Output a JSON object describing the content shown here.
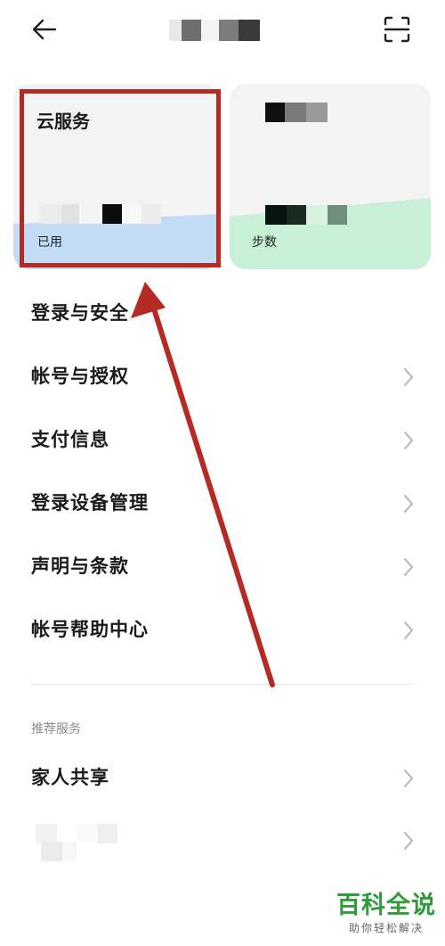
{
  "header": {
    "back_icon": "back-arrow-icon",
    "scan_icon": "scan-icon"
  },
  "cards": {
    "cloud": {
      "title": "云服务",
      "sub_label": "已用",
      "color": "#c2dcf6"
    },
    "steps": {
      "sub_label": "步数",
      "color": "#c7f0d6"
    }
  },
  "menu": [
    {
      "label": "登录与安全"
    },
    {
      "label": "帐号与授权"
    },
    {
      "label": "支付信息"
    },
    {
      "label": "登录设备管理"
    },
    {
      "label": "声明与条款"
    },
    {
      "label": "帐号帮助中心"
    }
  ],
  "recommended": {
    "heading": "推荐服务",
    "items": [
      {
        "label": "家人共享"
      }
    ]
  },
  "annotation": {
    "color": "#b52b24"
  },
  "watermark": {
    "main": "百科全说",
    "sub": "助你轻松解决"
  }
}
